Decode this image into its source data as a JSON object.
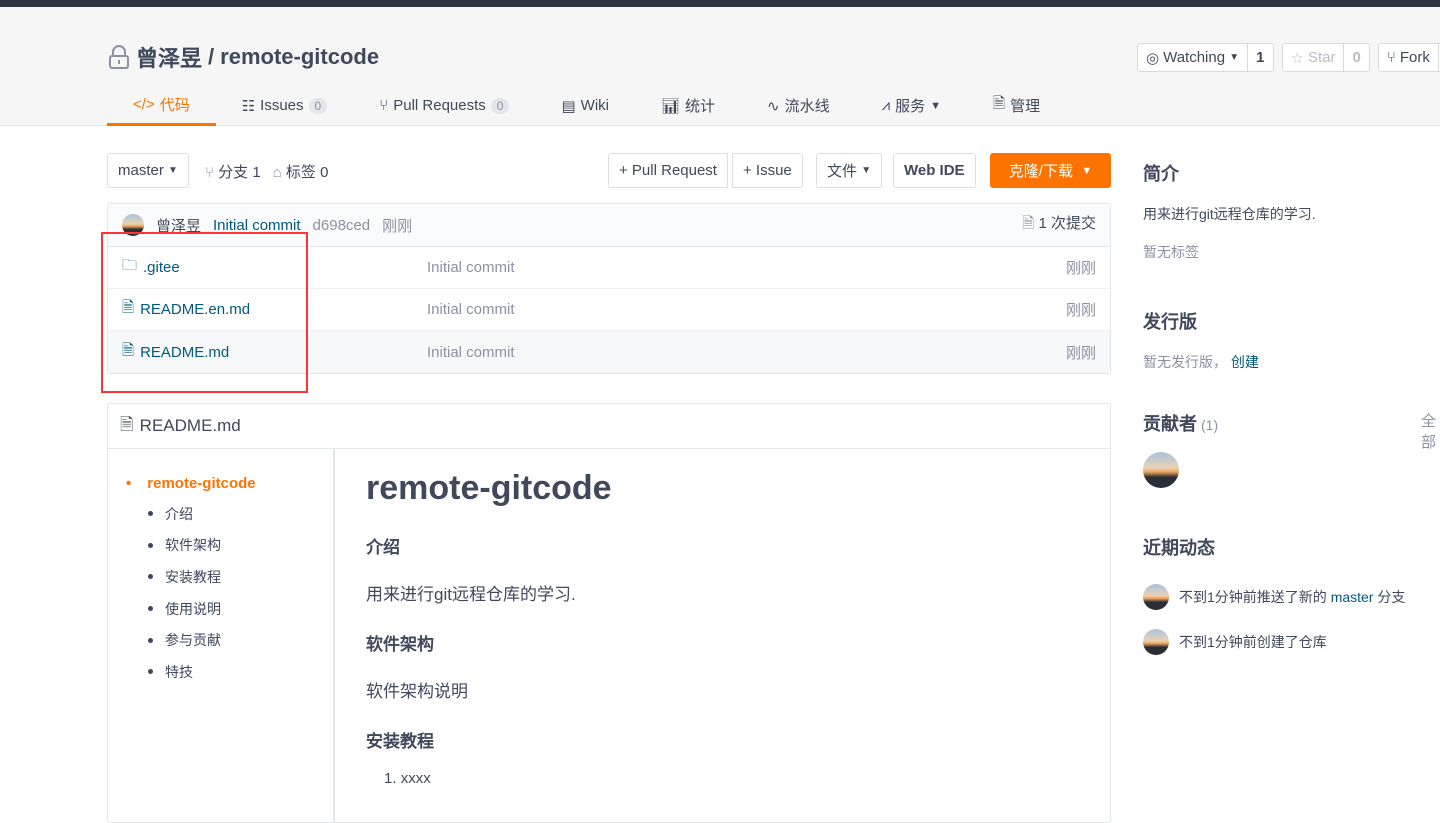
{
  "repo": {
    "owner": "曾泽昱",
    "sep": "/",
    "name": "remote-gitcode"
  },
  "nav": [
    {
      "label": "代码",
      "icon": "code-icon"
    },
    {
      "label": "Issues",
      "count": "0"
    },
    {
      "label": "Pull Requests",
      "count": "0"
    },
    {
      "label": "Wiki"
    },
    {
      "label": "统计"
    },
    {
      "label": "流水线"
    },
    {
      "label": "服务"
    },
    {
      "label": "管理"
    }
  ],
  "actions": {
    "watch": "Watching",
    "watch_count": "1",
    "star": "Star",
    "star_count": "0",
    "fork": "Fork"
  },
  "toolbar": {
    "branch": "master",
    "branches": "分支 1",
    "tags": "标签 0",
    "pr": "+ Pull Request",
    "issue": "+ Issue",
    "file": "文件",
    "webide": "Web IDE",
    "clone": "克隆/下载"
  },
  "commit": {
    "author": "曾泽昱",
    "message": "Initial commit",
    "hash": "d698ced",
    "time": "刚刚",
    "count": "1 次提交"
  },
  "files": [
    {
      "name": ".gitee",
      "type": "folder",
      "msg": "Initial commit",
      "time": "刚刚"
    },
    {
      "name": "README.en.md",
      "type": "file",
      "msg": "Initial commit",
      "time": "刚刚"
    },
    {
      "name": "README.md",
      "type": "file",
      "msg": "Initial commit",
      "time": "刚刚"
    }
  ],
  "readme": {
    "file": "README.md",
    "toc_top": "remote-gitcode",
    "toc": [
      "介绍",
      "软件架构",
      "安装教程",
      "使用说明",
      "参与贡献",
      "特技"
    ],
    "h1": "remote-gitcode",
    "h_intro": "介绍",
    "intro": "用来进行git远程仓库的学习.",
    "h_arch": "软件架构",
    "arch": "软件架构说明",
    "h_install": "安装教程",
    "install_1": "xxxx"
  },
  "sidebar": {
    "intro_title": "简介",
    "intro": "用来进行git远程仓库的学习.",
    "no_tags": "暂无标签",
    "release_title": "发行版",
    "no_release": "暂无发行版，",
    "create": "创建",
    "contrib_title": "贡献者",
    "contrib_count": "(1)",
    "all": "全部",
    "activity_title": "近期动态",
    "activity": [
      {
        "pre": "不到1分钟前推送了新的 ",
        "branch": "master",
        "post": " 分支"
      },
      {
        "pre": "不到1分钟前创建了仓库",
        "branch": "",
        "post": ""
      }
    ]
  },
  "colors": {
    "accent": "#fe7300",
    "link": "#005980",
    "highlight": "#ff3333"
  }
}
